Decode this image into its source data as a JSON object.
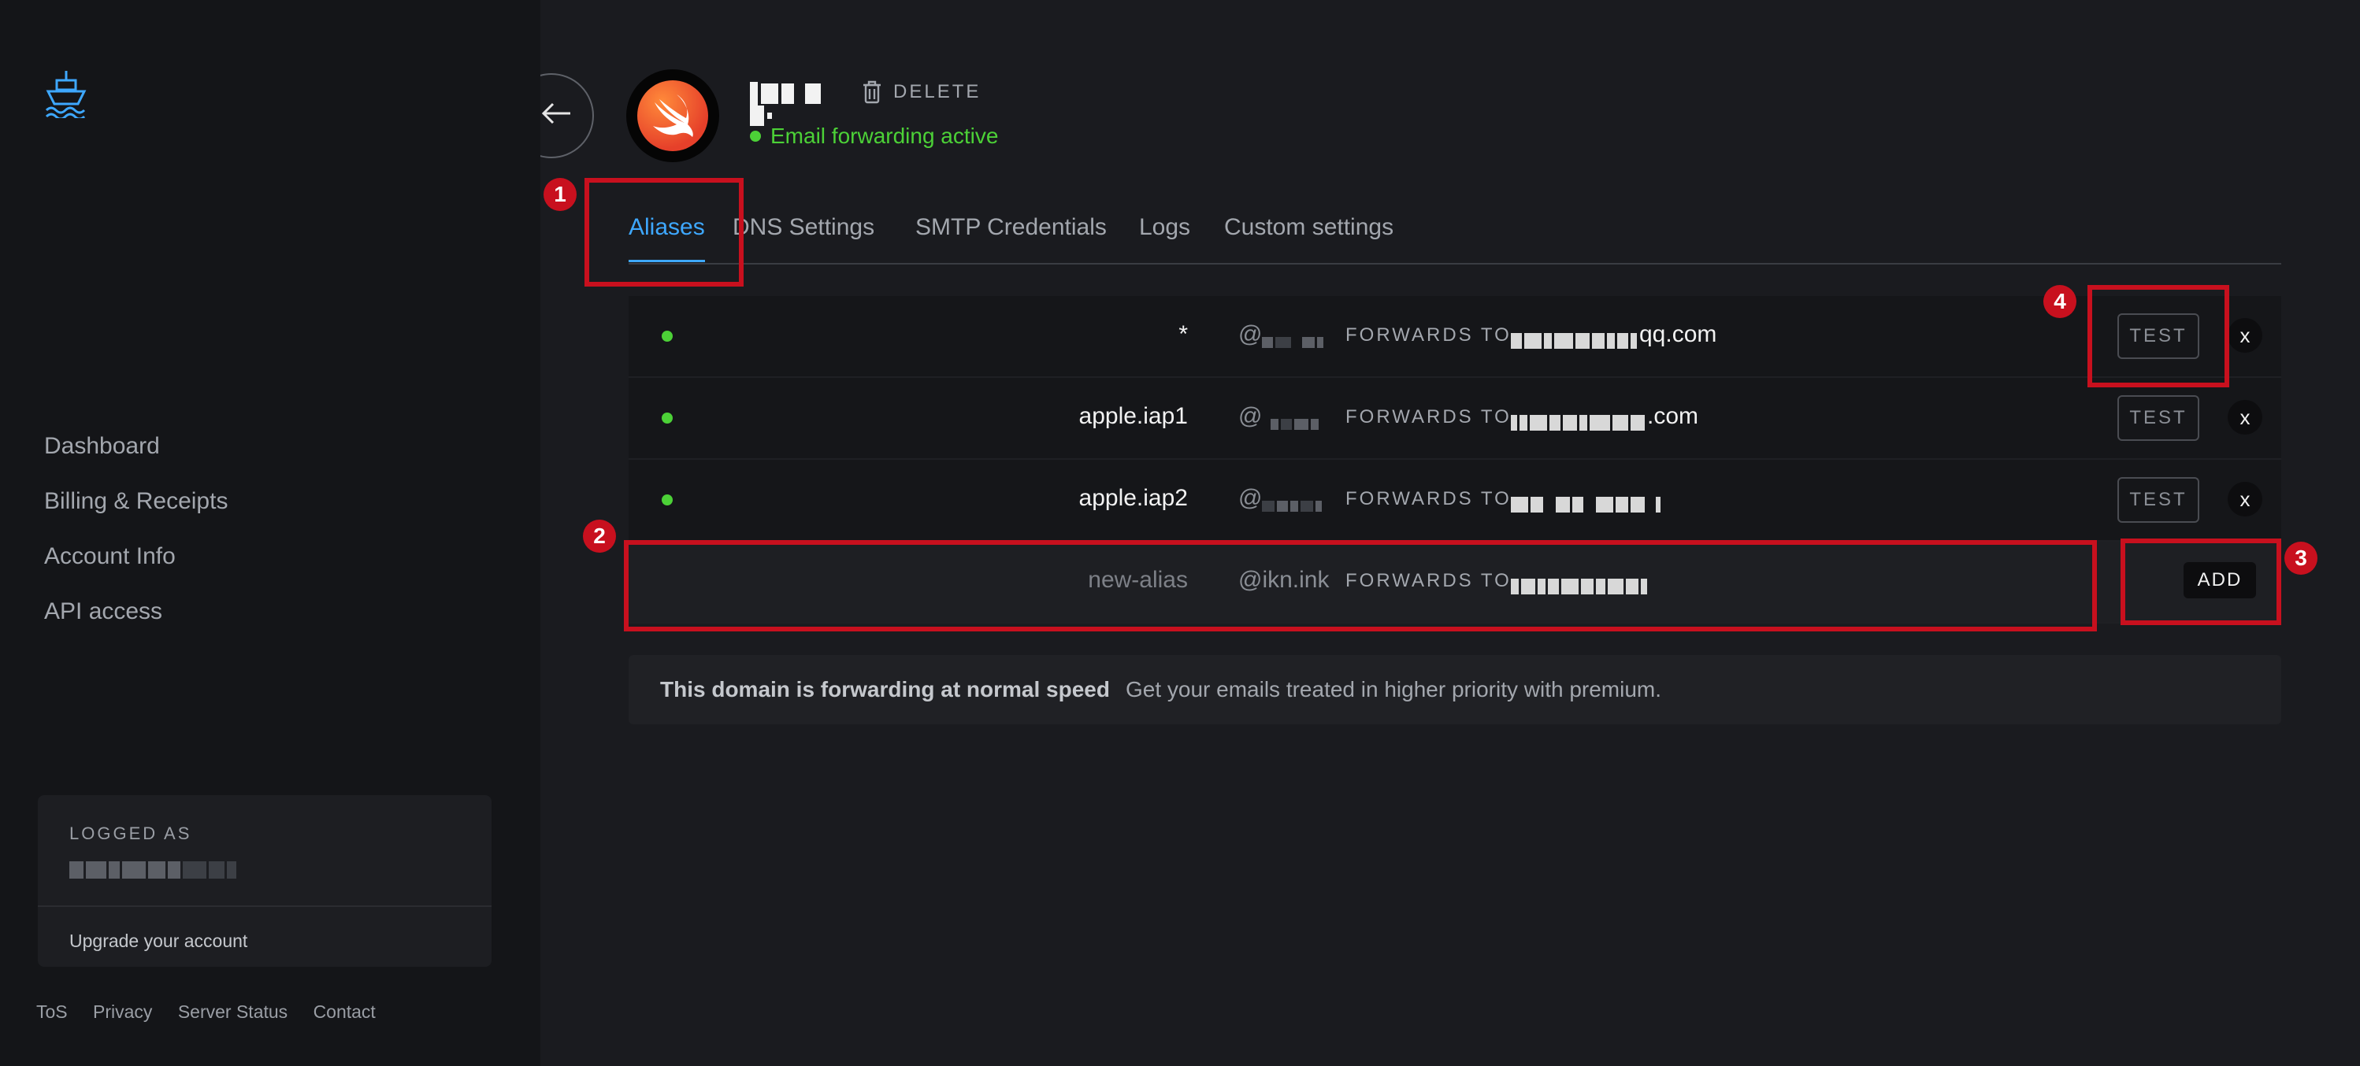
{
  "sidebar": {
    "nav": [
      "Dashboard",
      "Billing & Receipts",
      "Account Info",
      "API access"
    ],
    "user_card": {
      "label": "LOGGED AS",
      "upgrade": "Upgrade your account"
    },
    "footer": [
      "ToS",
      "Privacy",
      "Server Status",
      "Contact"
    ]
  },
  "header": {
    "delete_label": "DELETE",
    "status": "Email forwarding active"
  },
  "tabs": [
    "Aliases",
    "DNS Settings",
    "SMTP Credentials",
    "Logs",
    "Custom settings"
  ],
  "aliases": {
    "forwards_label": "FORWARDS TO",
    "test_label": "TEST",
    "close_label": "x",
    "rows": [
      {
        "alias": "*",
        "dest_suffix": "qq.com"
      },
      {
        "alias": "apple.iap1",
        "dest_suffix": ".com"
      },
      {
        "alias": "apple.iap2",
        "dest_suffix": ""
      }
    ],
    "new_row": {
      "placeholder": "new-alias",
      "domain": "@ikn.ink",
      "add_label": "ADD"
    }
  },
  "speed_banner": {
    "title": "This domain is forwarding at normal speed",
    "text": "Get your emails treated in higher priority with premium."
  },
  "annotations": [
    "1",
    "2",
    "3",
    "4"
  ],
  "colors": {
    "accent": "#3ea8ff",
    "status": "#4cd137",
    "annotation": "#c8101e"
  }
}
